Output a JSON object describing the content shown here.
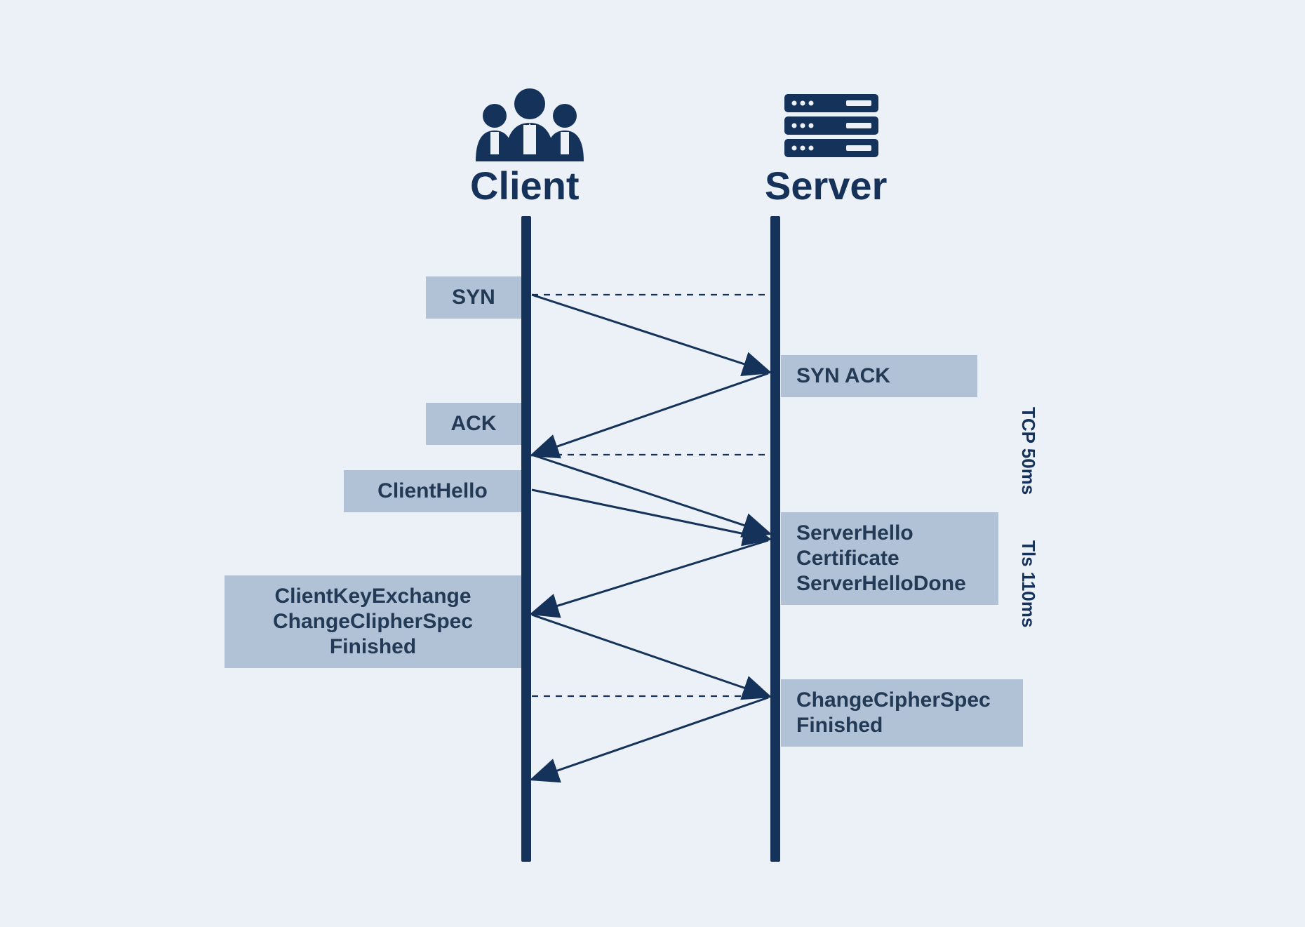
{
  "colors": {
    "accent": "#14325a",
    "box": "#b2c2d6",
    "bg": "#ecf0f7"
  },
  "participants": {
    "client_label": "Client",
    "server_label": "Server"
  },
  "messages": {
    "syn": "SYN",
    "synack": "SYN ACK",
    "ack": "ACK",
    "client_hello": "ClientHello",
    "server_hello_block": "ServerHello\nCertificate\nServerHelloDone",
    "client_key_block": "ClientKeyExchange\nChangeClipherSpec\nFinished",
    "server_ccs_block": "ChangeCipherSpec\nFinished"
  },
  "annotations": {
    "tcp": "TCP\n50ms",
    "tls": "Tls\n110ms"
  },
  "diagram": {
    "type": "sequence",
    "participants": [
      "Client",
      "Server"
    ],
    "arrows": [
      {
        "from": "Client",
        "to": "Server",
        "label_ref": "syn"
      },
      {
        "from": "Server",
        "to": "Client",
        "label_ref": "synack"
      },
      {
        "from": "Client",
        "to": "Server",
        "label_ref": "ack"
      },
      {
        "from": "Client",
        "to": "Server",
        "label_ref": "client_hello"
      },
      {
        "from": "Server",
        "to": "Client",
        "label_ref": "server_hello_block"
      },
      {
        "from": "Client",
        "to": "Server",
        "label_ref": "client_key_block"
      },
      {
        "from": "Server",
        "to": "Client",
        "label_ref": "server_ccs_block"
      }
    ],
    "brackets": [
      {
        "label_ref": "tcp",
        "covers": [
          "syn",
          "synack",
          "ack"
        ]
      },
      {
        "label_ref": "tls",
        "covers": [
          "client_hello",
          "server_hello_block",
          "client_key_block",
          "server_ccs_block"
        ]
      }
    ]
  }
}
